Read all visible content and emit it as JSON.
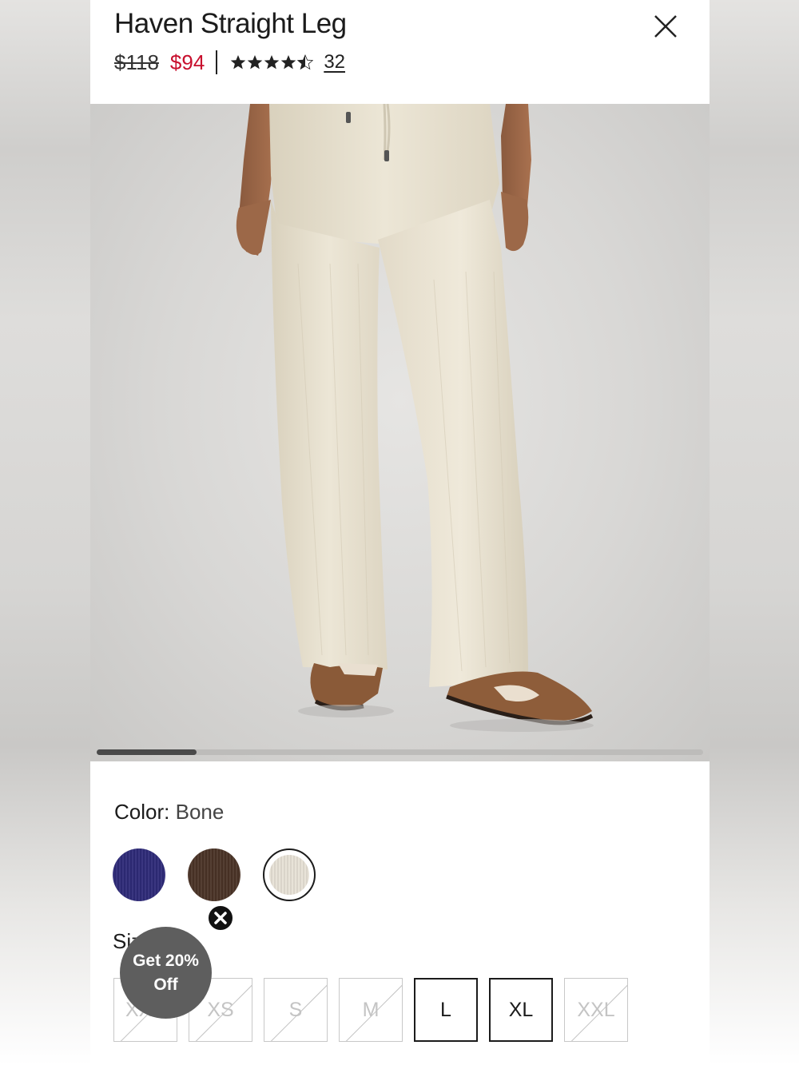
{
  "product": {
    "title": "Haven Straight Leg",
    "original_price": "$118",
    "sale_price": "$94",
    "rating": 4.5,
    "review_count": "32",
    "close_icon": "close-icon"
  },
  "gallery": {
    "image_description_icon": "product-photo",
    "current_image": 1,
    "scroll_fraction": 0.165
  },
  "color": {
    "label": "Color",
    "separator": ":",
    "selected_value": "Bone",
    "swatches": [
      {
        "name": "navy",
        "hex": "#2e2a78"
      },
      {
        "name": "brown",
        "hex": "#4a3326"
      },
      {
        "name": "bone",
        "hex": "#e7e1d6",
        "selected": true
      }
    ]
  },
  "size": {
    "label": "Size",
    "options": [
      {
        "label": "XXS",
        "available": false
      },
      {
        "label": "XS",
        "available": false
      },
      {
        "label": "S",
        "available": false
      },
      {
        "label": "M",
        "available": false
      },
      {
        "label": "L",
        "available": true
      },
      {
        "label": "XL",
        "available": true
      },
      {
        "label": "XXL",
        "available": false
      }
    ]
  },
  "promo": {
    "line1": "Get 20%",
    "line2": "Off",
    "close_icon": "close-icon"
  },
  "colors": {
    "sale_price": "#c8102e",
    "text": "#1b1b1b",
    "promo_bg": "#5e5e5e"
  }
}
